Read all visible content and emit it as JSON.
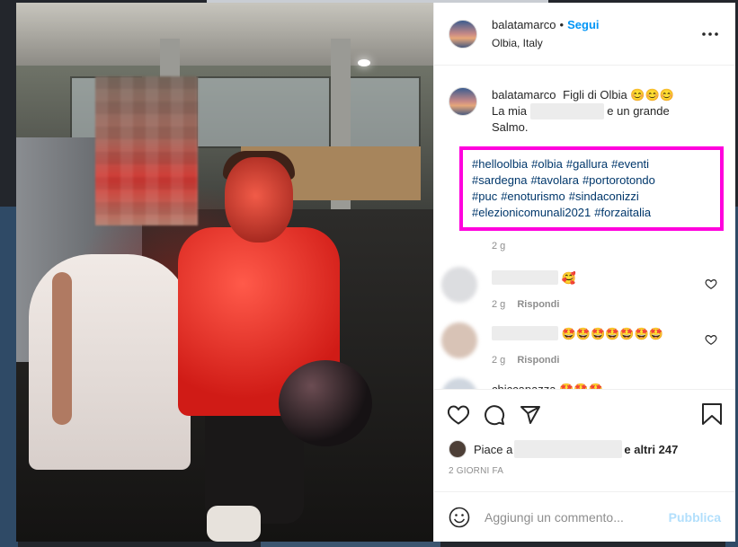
{
  "post": {
    "username": "balatamarco",
    "location": "Olbia, Italy",
    "follow_label": "Segui",
    "more_label": "•••"
  },
  "caption": {
    "username": "balatamarco",
    "line1": "Figli di Olbia 😊😊😊",
    "prefix": "La mia",
    "suffix": "e un grande",
    "line3": "Salmo.",
    "hashtags": [
      "#helloolbia",
      "#olbia",
      "#gallura",
      "#eventi",
      "#sardegna",
      "#tavolara",
      "#portorotondo",
      "#puc",
      "#enoturismo",
      "#sindaconizzi",
      "#elezionicomunali2021",
      "#forzaitalia"
    ],
    "time": "2 g"
  },
  "comments": [
    {
      "text": "🥰",
      "time": "2 g",
      "reply": "Rispondi"
    },
    {
      "text": "🤩🤩🤩🤩🤩🤩🤩",
      "time": "2 g",
      "reply": "Rispondi"
    },
    {
      "text": "chiccapazza 🤩🤩🤩"
    }
  ],
  "likes": {
    "prefix": "Piace a",
    "suffix": "e altri 247"
  },
  "date": "2 GIORNI FA",
  "add_comment": {
    "placeholder": "Aggiungi un commento...",
    "publish_label": "Pubblica"
  },
  "colors": {
    "link_blue": "#0095f6",
    "hashtag_blue": "#00376b",
    "highlight_magenta": "#ff00dd",
    "publish_disabled": "#b2dffc"
  },
  "icons": [
    "more-icon",
    "heart-icon",
    "comment-icon",
    "share-icon",
    "bookmark-icon",
    "emoji-icon",
    "like-small-icon"
  ]
}
